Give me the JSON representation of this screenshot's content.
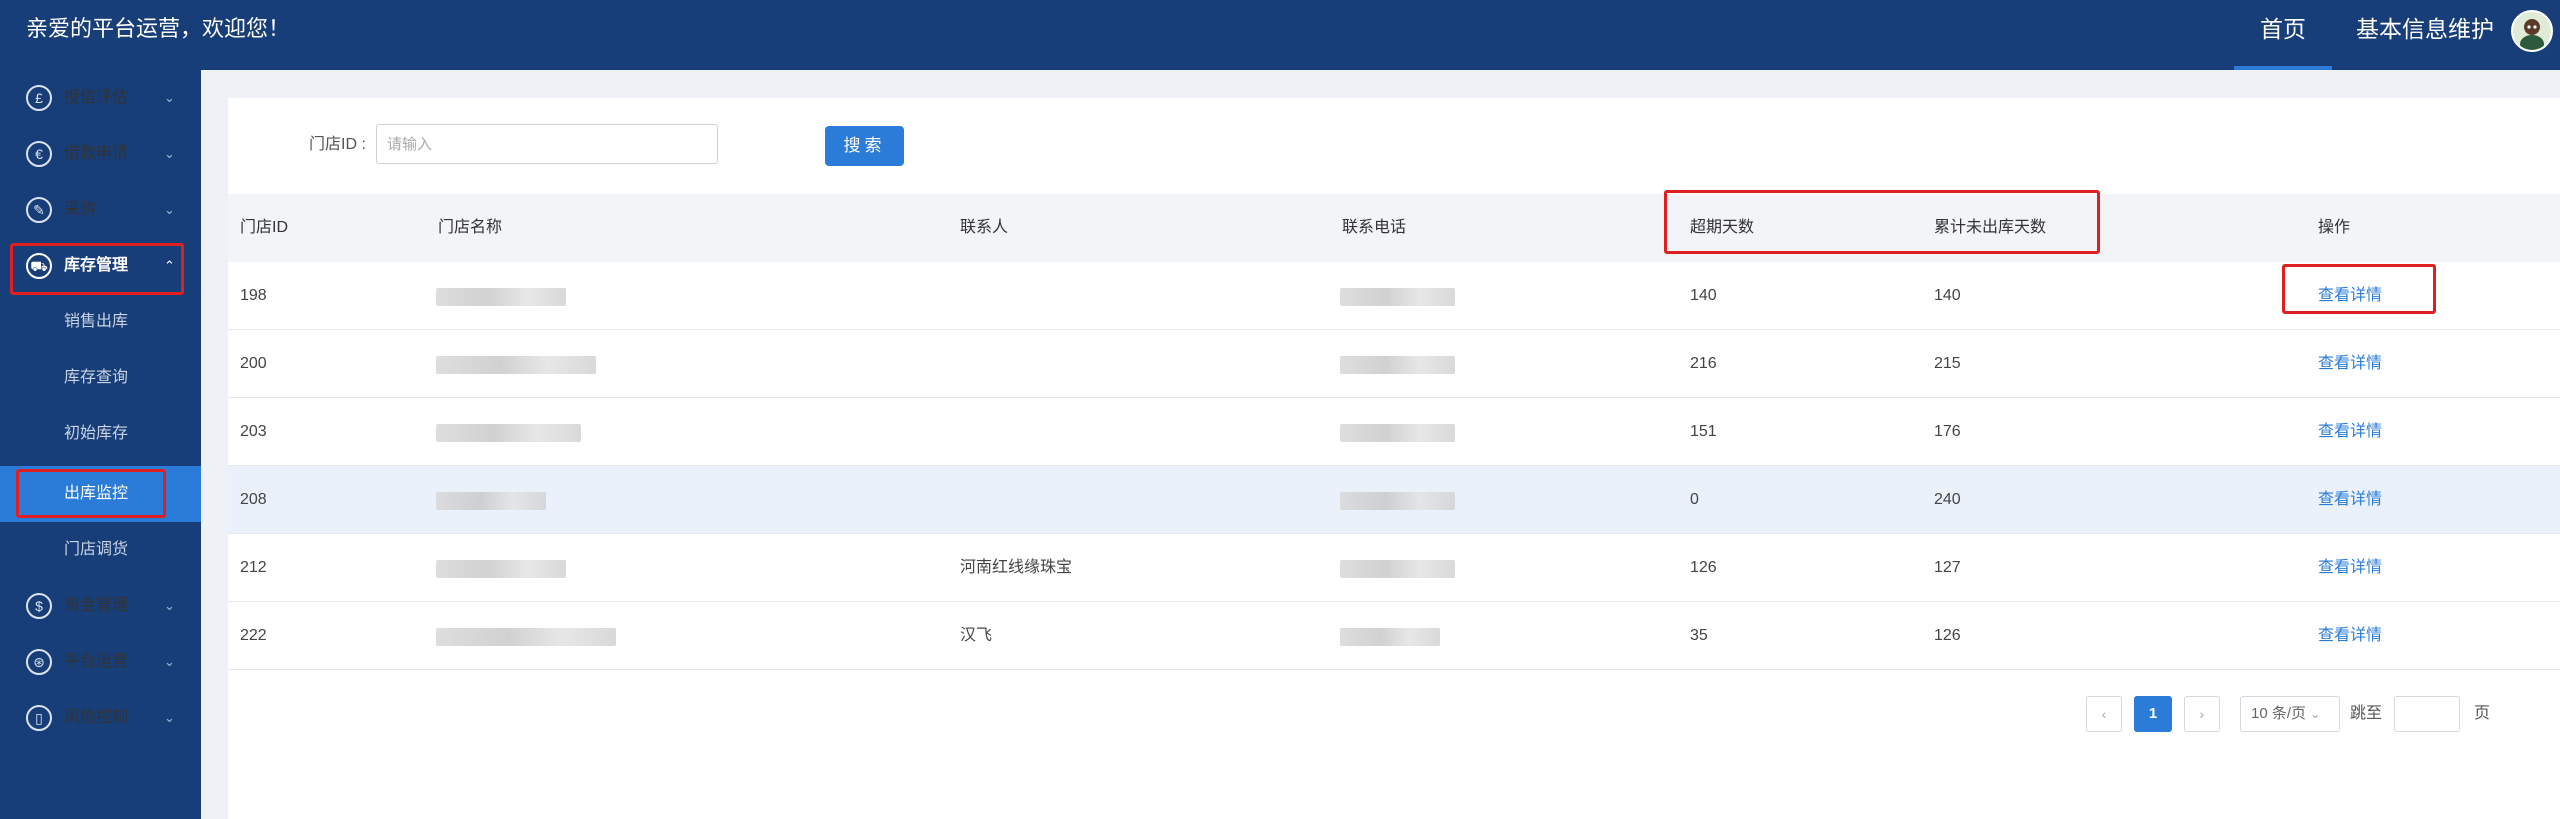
{
  "header": {
    "welcome": "亲爱的平台运营，欢迎您！",
    "nav": [
      "首页",
      "基本信息维护"
    ]
  },
  "sidebar": {
    "menus": [
      {
        "label": "授信评估",
        "icon": "pound-icon",
        "glyph": "£"
      },
      {
        "label": "借款申请",
        "icon": "euro-icon",
        "glyph": "€"
      },
      {
        "label": "采购",
        "icon": "tag-icon",
        "glyph": "✎"
      },
      {
        "label": "库存管理",
        "icon": "truck-icon",
        "glyph": "⛟"
      },
      {
        "label": "资金管理",
        "icon": "money-bag-icon",
        "glyph": "$"
      },
      {
        "label": "平台运营",
        "icon": "sitemap-icon",
        "glyph": "⊛"
      },
      {
        "label": "风险控制",
        "icon": "document-icon",
        "glyph": "▯"
      }
    ],
    "submenus": [
      "销售出库",
      "库存查询",
      "初始库存",
      "出库监控",
      "门店调货"
    ]
  },
  "search": {
    "label": "门店ID :",
    "placeholder": "请输入",
    "button": "搜索"
  },
  "table": {
    "headers": [
      "门店ID",
      "门店名称",
      "联系人",
      "联系电话",
      "超期天数",
      "累计未出库天数",
      "操作"
    ],
    "rows": [
      {
        "id": "198",
        "contact": "",
        "overdue": "140",
        "total": "140",
        "action": "查看详情"
      },
      {
        "id": "200",
        "contact": "",
        "overdue": "216",
        "total": "215",
        "action": "查看详情"
      },
      {
        "id": "203",
        "contact": "",
        "overdue": "151",
        "total": "176",
        "action": "查看详情"
      },
      {
        "id": "208",
        "contact": "",
        "overdue": "0",
        "total": "240",
        "action": "查看详情"
      },
      {
        "id": "212",
        "contact": "河南红线缘珠宝",
        "overdue": "126",
        "total": "127",
        "action": "查看详情"
      },
      {
        "id": "222",
        "contact": "汉飞",
        "overdue": "35",
        "total": "126",
        "action": "查看详情"
      }
    ]
  },
  "pagination": {
    "prev": "‹",
    "current": "1",
    "next": "›",
    "page_size": "10 条/页",
    "jump_label": "跳至",
    "page_suffix": "页"
  }
}
